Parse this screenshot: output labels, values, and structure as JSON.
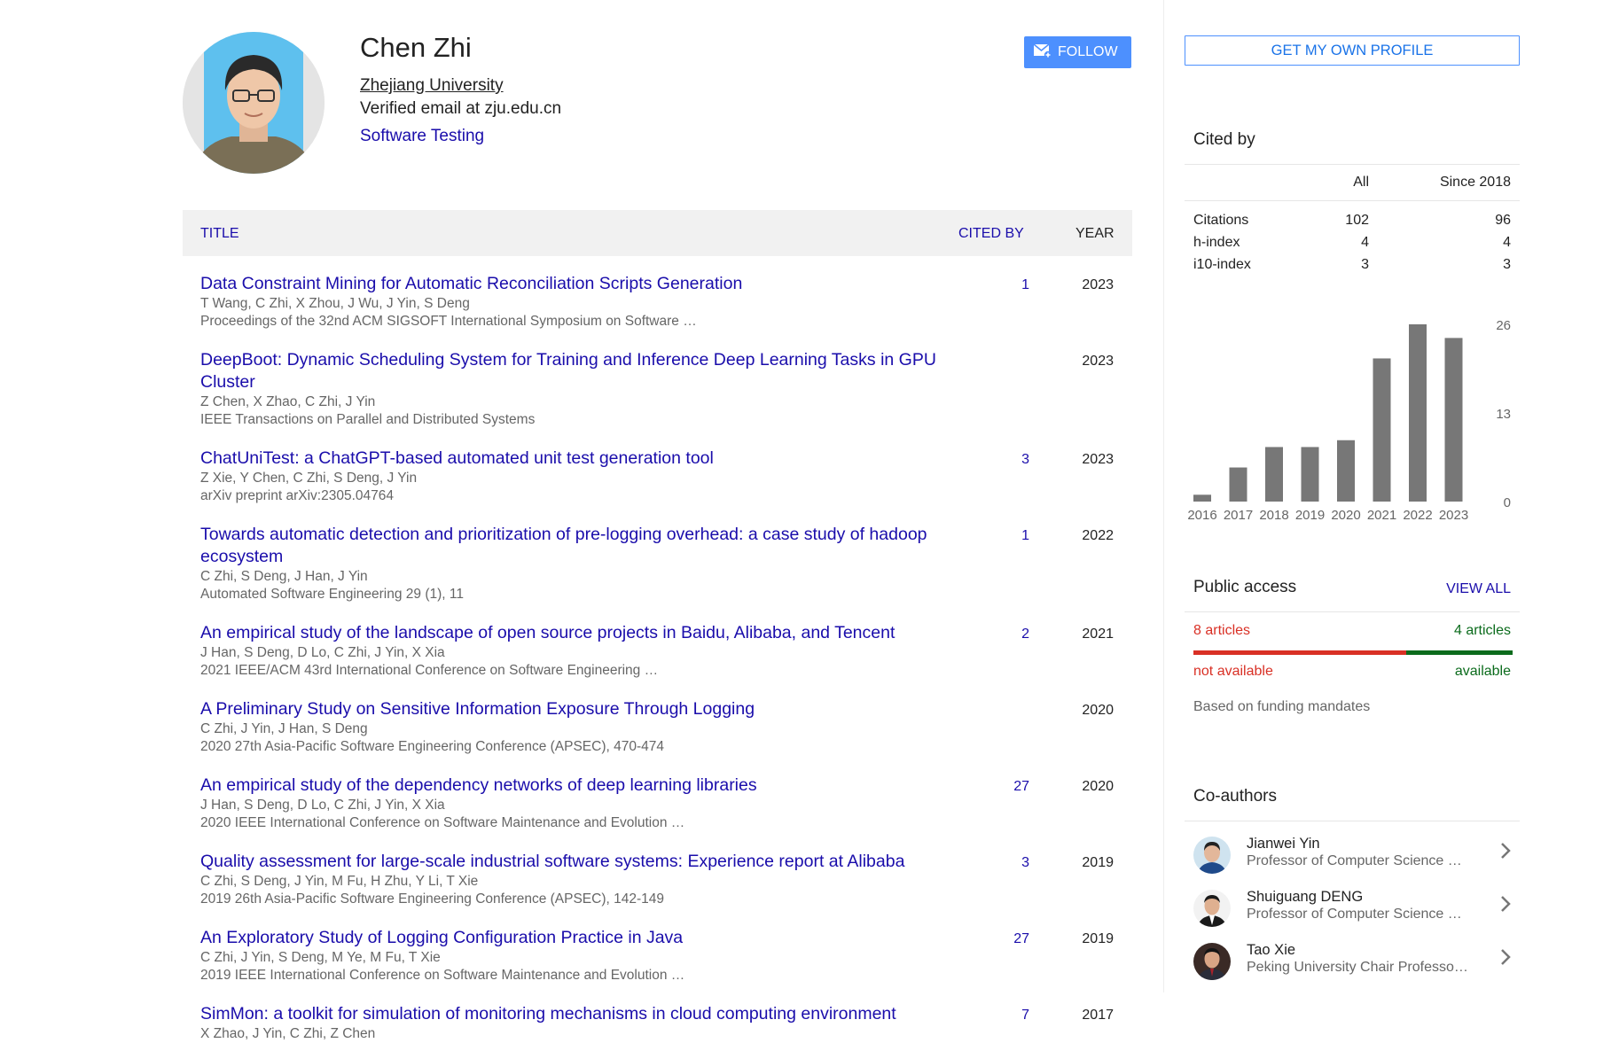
{
  "profile": {
    "name": "Chen Zhi",
    "affiliation": "Zhejiang University",
    "email": "Verified email at zju.edu.cn",
    "interest": "Software Testing",
    "follow_label": "FOLLOW"
  },
  "table": {
    "headers": {
      "title": "TITLE",
      "cited_by": "CITED BY",
      "year": "YEAR"
    },
    "rows": [
      {
        "title": "Data Constraint Mining for Automatic Reconciliation Scripts Generation",
        "authors": "T Wang, C Zhi, X Zhou, J Wu, J Yin, S Deng",
        "venue": "Proceedings of the 32nd ACM SIGSOFT International Symposium on Software …",
        "cited": "1",
        "year": "2023"
      },
      {
        "title": "DeepBoot: Dynamic Scheduling System for Training and Inference Deep Learning Tasks in GPU Cluster",
        "authors": "Z Chen, X Zhao, C Zhi, J Yin",
        "venue": "IEEE Transactions on Parallel and Distributed Systems",
        "cited": "",
        "year": "2023"
      },
      {
        "title": "ChatUniTest: a ChatGPT-based automated unit test generation tool",
        "authors": "Z Xie, Y Chen, C Zhi, S Deng, J Yin",
        "venue": "arXiv preprint arXiv:2305.04764",
        "cited": "3",
        "year": "2023"
      },
      {
        "title": "Towards automatic detection and prioritization of pre-logging overhead: a case study of hadoop ecosystem",
        "authors": "C Zhi, S Deng, J Han, J Yin",
        "venue": "Automated Software Engineering 29 (1), 11",
        "cited": "1",
        "year": "2022"
      },
      {
        "title": "An empirical study of the landscape of open source projects in Baidu, Alibaba, and Tencent",
        "authors": "J Han, S Deng, D Lo, C Zhi, J Yin, X Xia",
        "venue": "2021 IEEE/ACM 43rd International Conference on Software Engineering …",
        "cited": "2",
        "year": "2021"
      },
      {
        "title": "A Preliminary Study on Sensitive Information Exposure Through Logging",
        "authors": "C Zhi, J Yin, J Han, S Deng",
        "venue": "2020 27th Asia-Pacific Software Engineering Conference (APSEC), 470-474",
        "cited": "",
        "year": "2020"
      },
      {
        "title": "An empirical study of the dependency networks of deep learning libraries",
        "authors": "J Han, S Deng, D Lo, C Zhi, J Yin, X Xia",
        "venue": "2020 IEEE International Conference on Software Maintenance and Evolution …",
        "cited": "27",
        "year": "2020"
      },
      {
        "title": "Quality assessment for large-scale industrial software systems: Experience report at Alibaba",
        "authors": "C Zhi, S Deng, J Yin, M Fu, H Zhu, Y Li, T Xie",
        "venue": "2019 26th Asia-Pacific Software Engineering Conference (APSEC), 142-149",
        "cited": "3",
        "year": "2019"
      },
      {
        "title": "An Exploratory Study of Logging Configuration Practice in Java",
        "authors": "C Zhi, J Yin, S Deng, M Ye, M Fu, T Xie",
        "venue": "2019 IEEE International Conference on Software Maintenance and Evolution …",
        "cited": "27",
        "year": "2019"
      },
      {
        "title": "SimMon: a toolkit for simulation of monitoring mechanisms in cloud computing environment",
        "authors": "X Zhao, J Yin, C Zhi, Z Chen",
        "venue": "",
        "cited": "7",
        "year": "2017"
      }
    ]
  },
  "sidebar": {
    "own_profile_label": "GET MY OWN PROFILE",
    "cited_by": {
      "heading": "Cited by",
      "col_all": "All",
      "col_since": "Since 2018",
      "metrics": [
        {
          "label": "Citations",
          "all": "102",
          "since": "96"
        },
        {
          "label": "h-index",
          "all": "4",
          "since": "4"
        },
        {
          "label": "i10-index",
          "all": "3",
          "since": "3"
        }
      ]
    },
    "public_access": {
      "heading": "Public access",
      "view_all": "VIEW ALL",
      "not_available_count": "8 articles",
      "available_count": "4 articles",
      "not_available_label": "not available",
      "available_label": "available",
      "note": "Based on funding mandates",
      "not_available_color": "#d93025",
      "available_color": "#0b6b1c"
    },
    "coauthors": {
      "heading": "Co-authors",
      "items": [
        {
          "name": "Jianwei Yin",
          "affiliation": "Professor of Computer Science …"
        },
        {
          "name": "Shuiguang DENG",
          "affiliation": "Professor of Computer Science …"
        },
        {
          "name": "Tao Xie",
          "affiliation": "Peking University Chair Professo…"
        }
      ]
    }
  },
  "chart_data": {
    "type": "bar",
    "categories": [
      "2016",
      "2017",
      "2018",
      "2019",
      "2020",
      "2021",
      "2022",
      "2023"
    ],
    "values": [
      1,
      5,
      8,
      8,
      9,
      21,
      26,
      24
    ],
    "ylim": [
      0,
      26
    ],
    "yticks": [
      "26",
      "13",
      "0"
    ],
    "grid": false,
    "bar_color": "#777777"
  }
}
